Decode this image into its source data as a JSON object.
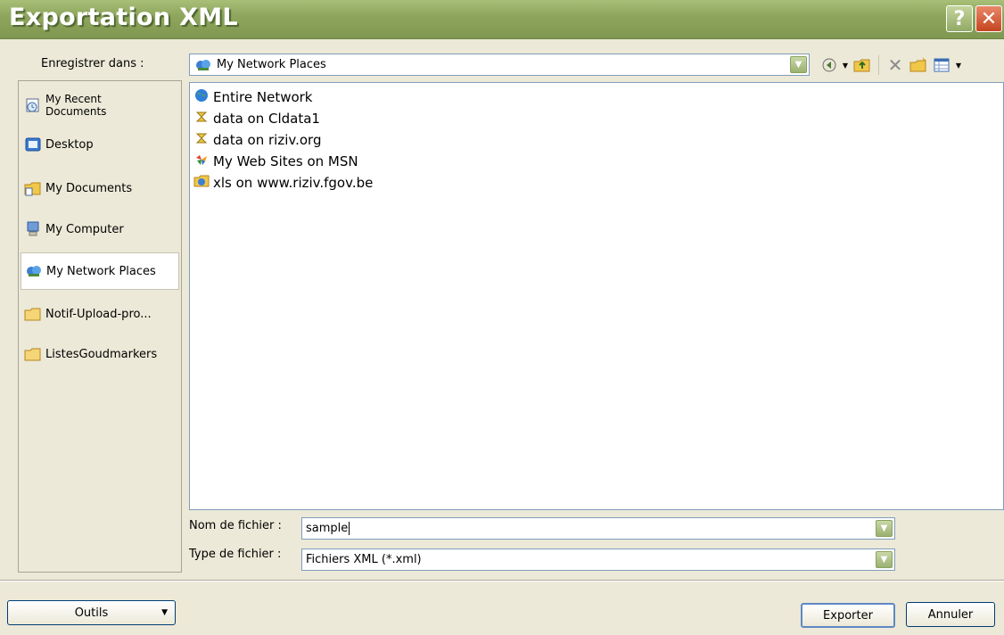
{
  "window": {
    "title": "Exportation XML",
    "help_glyph": "?",
    "close_glyph": "✕"
  },
  "save_in": {
    "label": "Enregistrer dans :",
    "value": "My Network Places"
  },
  "toolbar": {
    "icons": [
      "back-icon",
      "up-folder-icon",
      "delete-icon",
      "new-folder-icon",
      "views-icon"
    ]
  },
  "places": [
    {
      "label": "My Recent Documents",
      "line1": "My Recent",
      "line2": "Documents",
      "icon": "recent-documents-icon"
    },
    {
      "label": "Desktop",
      "icon": "desktop-icon"
    },
    {
      "label": "My Documents",
      "icon": "my-documents-icon"
    },
    {
      "label": "My Computer",
      "icon": "my-computer-icon"
    },
    {
      "label": "My Network Places",
      "icon": "network-places-icon",
      "selected": true
    },
    {
      "label": "Notif-Upload-pro...",
      "icon": "folder-icon"
    },
    {
      "label": "ListesGoudmarkers",
      "icon": "folder-icon"
    }
  ],
  "files": [
    {
      "name": "Entire Network",
      "icon": "globe-icon"
    },
    {
      "name": "data on Cldata1",
      "icon": "network-share-icon"
    },
    {
      "name": "data on riziv.org",
      "icon": "network-share-icon"
    },
    {
      "name": "My Web Sites on MSN",
      "icon": "msn-icon"
    },
    {
      "name": "xls on www.riziv.fgov.be",
      "icon": "web-folder-icon"
    }
  ],
  "filename": {
    "label": "Nom de fichier :",
    "value": "sample"
  },
  "filetype": {
    "label": "Type de fichier :",
    "value": "Fichiers XML (*.xml)"
  },
  "buttons": {
    "tools": "Outils",
    "export": "Exporter",
    "cancel": "Annuler"
  },
  "colors": {
    "titlebar": "#8fa65e",
    "dialog_bg": "#ece9d8",
    "close_button": "#c4451f"
  }
}
